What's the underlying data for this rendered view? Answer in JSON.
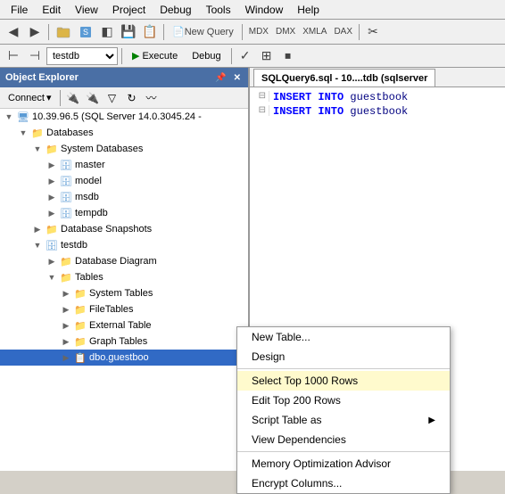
{
  "menubar": {
    "items": [
      "File",
      "Edit",
      "View",
      "Project",
      "Debug",
      "Tools",
      "Window",
      "Help"
    ]
  },
  "toolbar": {
    "back_label": "◀",
    "forward_label": "▶",
    "separator": "|",
    "new_query_label": "New Query",
    "db_dropdown_value": "testdb"
  },
  "toolbar2": {
    "execute_label": "Execute",
    "debug_label": "Debug"
  },
  "object_explorer": {
    "title": "Object Explorer",
    "connect_label": "Connect",
    "server": "10.39.96.5 (SQL Server 14.0.3045.24 -",
    "databases_label": "Databases",
    "system_databases_label": "System Databases",
    "master_label": "master",
    "model_label": "model",
    "msdb_label": "msdb",
    "tempdb_label": "tempdb",
    "db_snapshots_label": "Database Snapshots",
    "testdb_label": "testdb",
    "db_diagrams_label": "Database Diagram",
    "tables_label": "Tables",
    "system_tables_label": "System Tables",
    "filetables_label": "FileTables",
    "external_tables_label": "External Table",
    "graph_tables_label": "Graph Tables",
    "selected_table": "dbo.guestboo"
  },
  "sql_panel": {
    "tab_label": "SQLQuery6.sql - 10....tdb (sqlserver",
    "lines": [
      {
        "num": "",
        "code": "INSERT INTO guestbook"
      },
      {
        "num": "",
        "code": "INSERT INTO guestbook"
      }
    ]
  },
  "context_menu": {
    "items": [
      {
        "label": "New Table...",
        "has_arrow": false,
        "highlighted": false
      },
      {
        "label": "Design",
        "has_arrow": false,
        "highlighted": false
      },
      {
        "label": "Select Top 1000 Rows",
        "has_arrow": false,
        "highlighted": true
      },
      {
        "label": "Edit Top 200 Rows",
        "has_arrow": false,
        "highlighted": false
      },
      {
        "label": "Script Table as",
        "has_arrow": true,
        "highlighted": false
      },
      {
        "label": "View Dependencies",
        "has_arrow": false,
        "highlighted": false
      },
      {
        "label": "Memory Optimization Advisor",
        "has_arrow": false,
        "highlighted": false
      },
      {
        "label": "Encrypt Columns...",
        "has_arrow": false,
        "highlighted": false
      }
    ]
  }
}
